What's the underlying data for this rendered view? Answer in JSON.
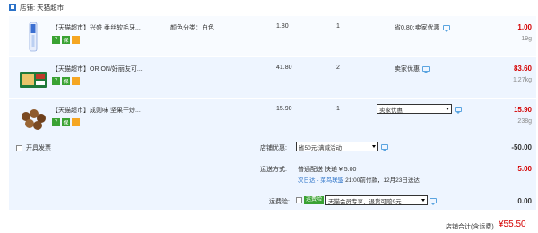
{
  "shop": {
    "label": "店铺: 天猫超市"
  },
  "items": [
    {
      "title": "【天猫超市】兴盛 柔丝软毛牙...",
      "spec": "颜色分类：白色",
      "unit_price": "1.80",
      "qty": "1",
      "promo": "省0.80:卖家优惠",
      "total": "1.00",
      "weight": "19g"
    },
    {
      "title": "【天猫超市】ORION/好丽友可...",
      "spec": "",
      "unit_price": "41.80",
      "qty": "2",
      "promo": "卖家优惠",
      "total": "83.60",
      "weight": "1.27kg"
    },
    {
      "title": "【天猫超市】成则味 坚果干炒...",
      "spec": "",
      "unit_price": "15.90",
      "qty": "1",
      "promo_select": "卖家优惠",
      "total": "15.90",
      "weight": "238g"
    }
  ],
  "badges": {
    "seven": "7",
    "guarantee": "保"
  },
  "summary": {
    "invoice_label": "开具发票",
    "shop_discount_label": "店铺优惠:",
    "shop_discount_select": "省50元:满减活动",
    "shop_discount_amount": "-50.00",
    "shipping_label": "运送方式:",
    "shipping_method": "普通配送 快递 ¥ 5.00",
    "shipping_sub_link": "次日达 - 菜鸟联盟",
    "shipping_sub_text": "21:00前付款，12月23日送达",
    "shipping_amount": "5.00",
    "insurance_label": "运费险:",
    "insurance_tag": "运费险",
    "insurance_select": "天猫会员专享，退货可赔9元",
    "insurance_amount": "0.00"
  },
  "footer": {
    "label": "店铺合计(含运费)",
    "amount": "¥55.50"
  },
  "colors": {
    "accent": "#2b72c8",
    "price_red": "#d40000",
    "badge_green": "#3aa233",
    "row_bg": "#eef5ff"
  }
}
